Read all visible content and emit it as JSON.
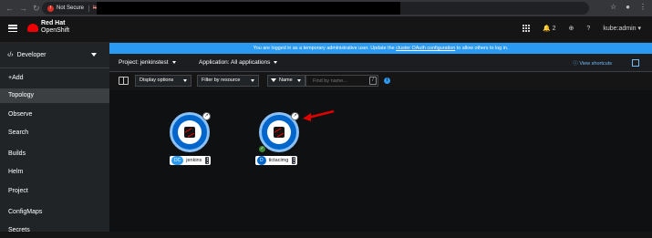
{
  "browser": {
    "security_label": "Not Secure",
    "url_prefix": "https://"
  },
  "masthead": {
    "brand_line1": "Red Hat",
    "brand_line2": "OpenShift",
    "notifications_count": "2",
    "user": "kube:admin"
  },
  "sidebar": {
    "perspective": "Developer",
    "items": [
      {
        "label": "+Add"
      },
      {
        "label": "Topology"
      },
      {
        "label": "Observe"
      },
      {
        "label": "Search"
      },
      {
        "label": "Builds"
      },
      {
        "label": "Helm"
      },
      {
        "label": "Project"
      },
      {
        "label": "ConfigMaps"
      },
      {
        "label": "Secrets"
      }
    ]
  },
  "banner": {
    "text_before": "You are logged in as a temporary administrative user. Update the ",
    "link": "cluster OAuth configuration",
    "text_after": " to allow others to log in."
  },
  "project_bar": {
    "project": "Project: jenkinstest",
    "application": "Application: All applications",
    "shortcuts": "View shortcuts"
  },
  "toolbar": {
    "display_options": "Display options",
    "filter": "Filter by resource",
    "name": "Name",
    "search_placeholder": "Find by name...",
    "slash": "/"
  },
  "topology": {
    "nodes": [
      {
        "badge": "DC",
        "name": "jenkins",
        "badge_color": "#2b9af3"
      },
      {
        "badge": "D",
        "name": "tictacimg",
        "badge_color": "#0066cc"
      }
    ]
  },
  "colors": {
    "banner": "#2b9af3",
    "brand_red": "#ee0000",
    "arrow": "#e00000",
    "status_ok": "#3e8635"
  }
}
